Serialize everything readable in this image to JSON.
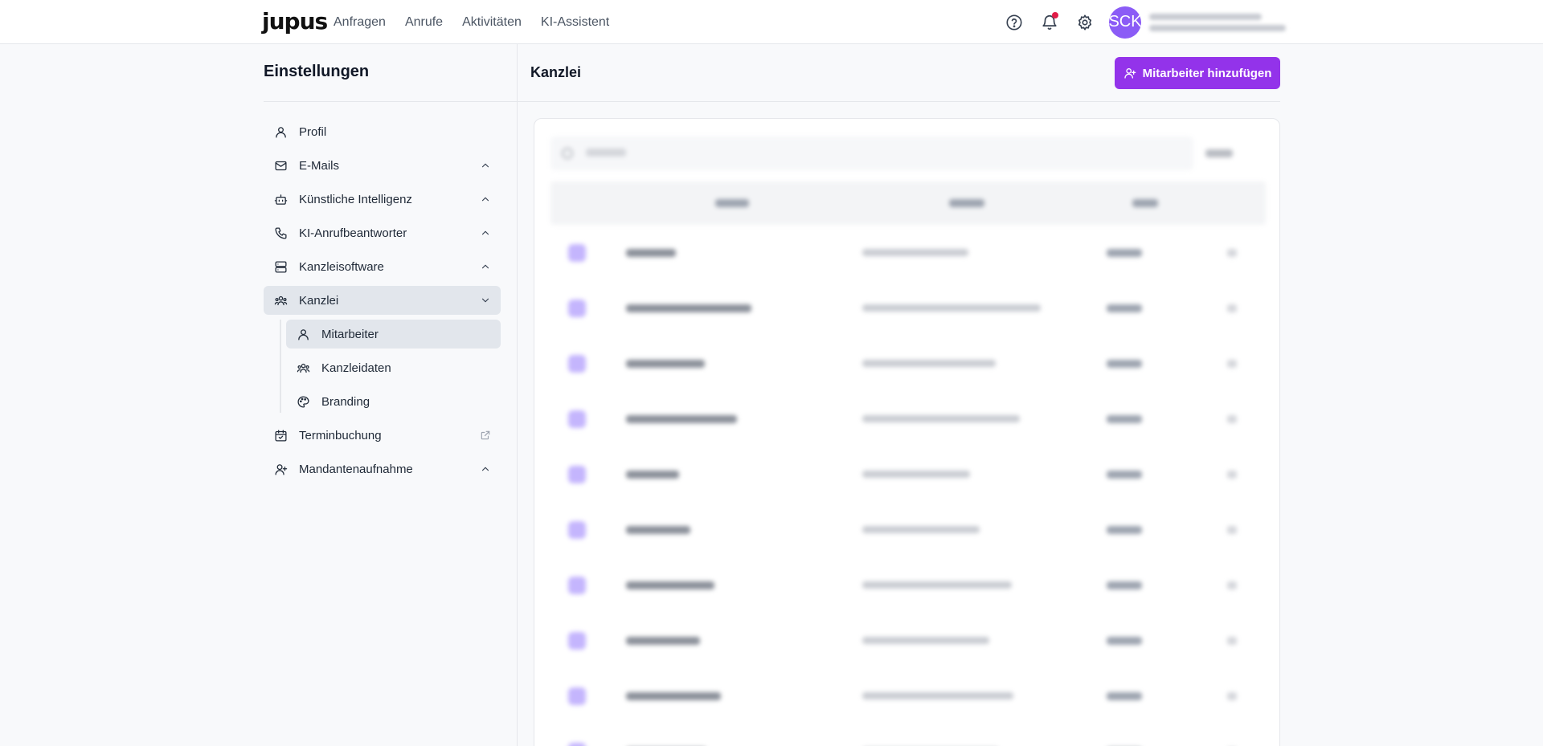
{
  "header": {
    "logo": "jupus",
    "nav": [
      "Anfragen",
      "Anrufe",
      "Aktivitäten",
      "KI-Assistent"
    ],
    "avatar_initials": "SCK"
  },
  "sidebar": {
    "title": "Einstellungen",
    "items": [
      {
        "label": "Profil",
        "icon": "user-icon"
      },
      {
        "label": "E-Mails",
        "icon": "mail-icon"
      },
      {
        "label": "Künstliche Intelligenz",
        "icon": "bot-icon"
      },
      {
        "label": "KI-Anrufbeantworter",
        "icon": "phone-icon"
      },
      {
        "label": "Kanzleisoftware",
        "icon": "server-icon"
      },
      {
        "label": "Kanzlei",
        "icon": "people-icon"
      },
      {
        "label": "Terminbuchung",
        "icon": "calendar-icon"
      },
      {
        "label": "Mandantenaufnahme",
        "icon": "user-plus-icon"
      }
    ],
    "sub_items": [
      {
        "label": "Mitarbeiter",
        "icon": "user-icon"
      },
      {
        "label": "Kanzleidaten",
        "icon": "people-icon"
      },
      {
        "label": "Branding",
        "icon": "palette-icon"
      }
    ]
  },
  "main": {
    "title": "Kanzlei",
    "add_button": "Mitarbeiter hinzufügen"
  },
  "colors": {
    "accent": "#9333ea",
    "avatar": "#8b5cf6",
    "notification": "#e11d48",
    "active_item": "#e2e6ec"
  }
}
